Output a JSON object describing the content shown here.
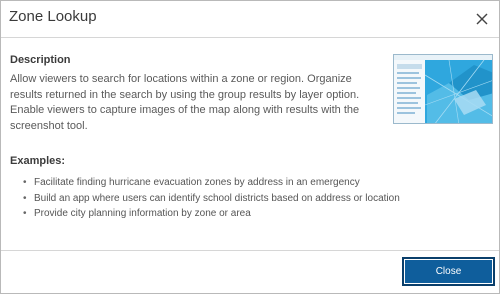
{
  "dialog": {
    "title": "Zone Lookup",
    "close_icon": "close-icon"
  },
  "content": {
    "description_heading": "Description",
    "description_text": "Allow viewers to search for locations within a zone or region. Organize results returned in the search by using the group results by layer option. Enable viewers to capture images of the map along with results with the screenshot tool.",
    "examples_heading": "Examples:",
    "examples": [
      "Facilitate finding hurricane evacuation zones by address in an emergency",
      "Build an app where users can identify school districts based on address or location",
      "Provide city planning information by zone or area"
    ],
    "thumbnail_icon": "app-preview-thumbnail"
  },
  "footer": {
    "close_label": "Close"
  },
  "colors": {
    "primary_button": "#0f5e9c",
    "map_blue": "#2fa7de"
  }
}
